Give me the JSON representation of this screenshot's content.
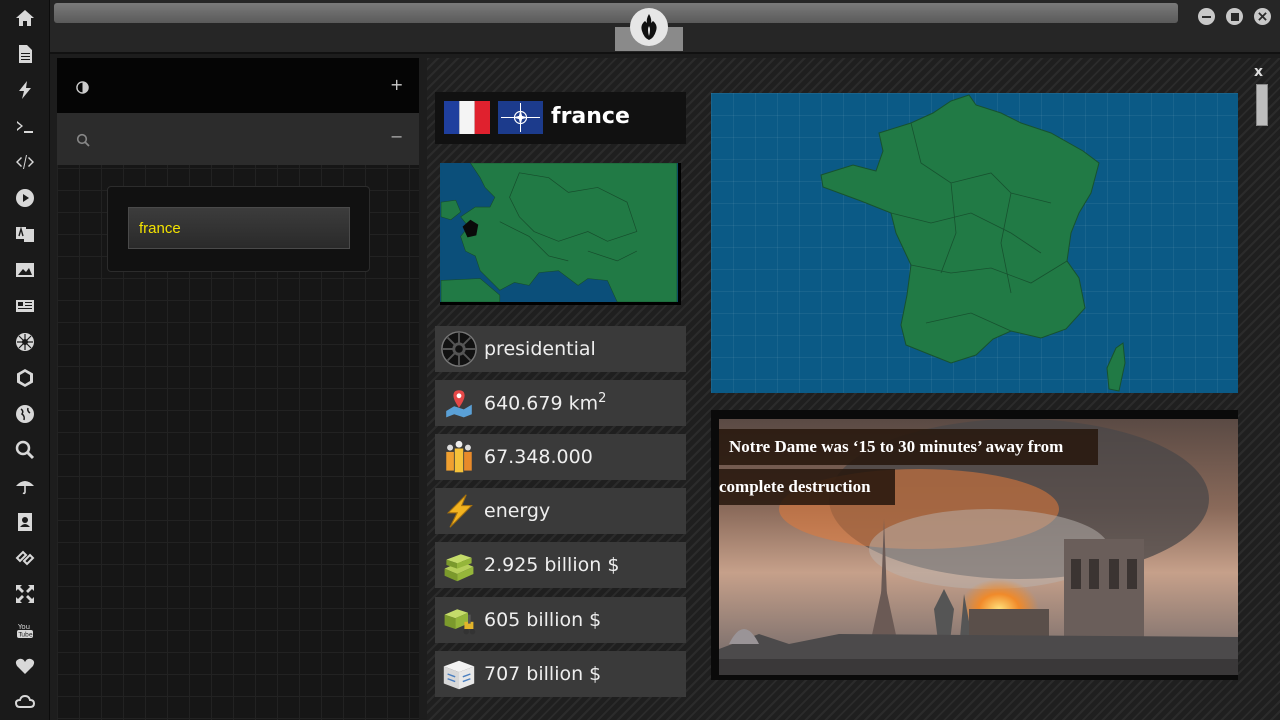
{
  "sidebar": {
    "icons": [
      "home-icon",
      "document-icon",
      "bolt-icon",
      "terminal-icon",
      "code-icon",
      "play-icon",
      "translate-icon",
      "image-icon",
      "newspaper-icon",
      "empire-icon",
      "hexagon-icon",
      "globe-icon",
      "search-icon",
      "umbrella-icon",
      "contacts-icon",
      "link-icon",
      "expand-icon",
      "youtube-icon",
      "heart-icon",
      "cloud-icon"
    ]
  },
  "left_panel": {
    "search_value": "france"
  },
  "country": {
    "name": "france",
    "government": "presidential",
    "area": "640.679 km",
    "area_unit_sup": "2",
    "population": "67.348.000",
    "industry": "energy",
    "gdp": "2.925 billion $",
    "exports": "605 billion $",
    "imports": "707 billion $"
  },
  "news": {
    "headline_line1": "Notre Dame was ‘15 to 30 minutes’ away from",
    "headline_line2": "complete destruction"
  },
  "window": {
    "close_label": "x"
  },
  "colors": {
    "accent_yellow": "#f2e200",
    "land_green": "#217a45",
    "sea_blue": "#0b5a86"
  }
}
